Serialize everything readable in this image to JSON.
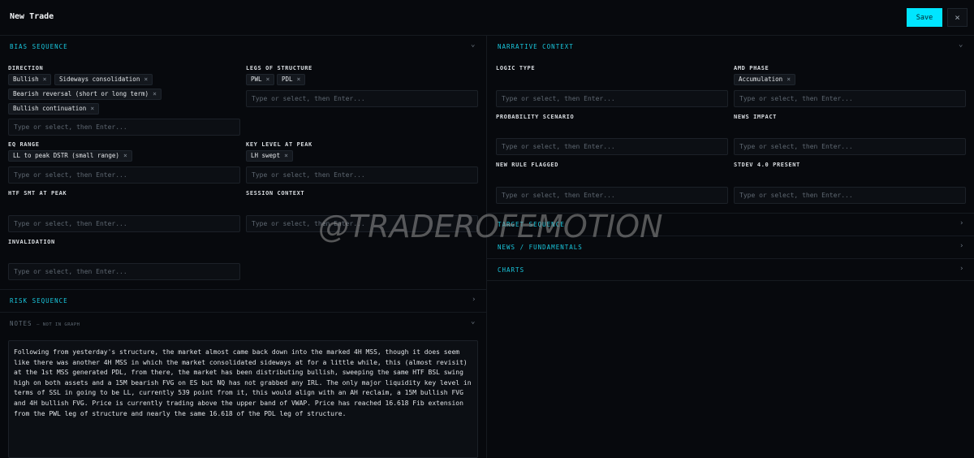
{
  "header": {
    "title": "New Trade",
    "save_label": "Save",
    "close_glyph": "×"
  },
  "placeholder": "Type or select, then Enter...",
  "remove_glyph": "×",
  "chevrons": {
    "collapse": "⌄",
    "expand": "›"
  },
  "bias": {
    "title": "BIAS SEQUENCE",
    "direction": {
      "label": "DIRECTION",
      "tags": [
        "Bullish",
        "Sideways consolidation",
        "Bearish reversal (short or long term)",
        "Bullish continuation"
      ]
    },
    "legs": {
      "label": "LEGS OF STRUCTURE",
      "tags": [
        "PWL",
        "PDL"
      ]
    },
    "eq_range": {
      "label": "EQ RANGE",
      "tags": [
        "LL to peak DSTR (small range)"
      ]
    },
    "key_level": {
      "label": "KEY LEVEL AT PEAK",
      "tags": [
        "LH swept"
      ]
    },
    "htf_smt": {
      "label": "HTF SMT AT PEAK"
    },
    "session": {
      "label": "SESSION CONTEXT"
    },
    "invalidation": {
      "label": "INVALIDATION"
    }
  },
  "risk": {
    "title": "RISK SEQUENCE"
  },
  "notes": {
    "title": "NOTES",
    "subtitle": "— NOT IN GRAPH",
    "text": "Following from yesterday's structure, the market almost came back down into the marked 4H MSS, though it does seem like there was another 4H MSS in which the market consolidated sideways at for a little while, this (almost revisit) at the 1st MSS generated PDL, from there, the market has been distributing bullish, sweeping the same HTF BSL swing high on both assets and a 15M bearish FVG on ES but NQ has not grabbed any IRL. The only major liquidity key level in terms of SSL in going to be LL, currently 539 point from it, this would align with an AH reclaim, a 15M bullish FVG and 4H bullish FVG. Price is currently trading above the upper band of VWAP. Price has reached 16.618 Fib extension from the PWL leg of structure and nearly the same 16.618 of the PDL leg of structure."
  },
  "narrative": {
    "title": "NARRATIVE CONTEXT",
    "logic_type": {
      "label": "LOGIC TYPE"
    },
    "amd_phase": {
      "label": "AMD PHASE",
      "tags": [
        "Accumulation"
      ]
    },
    "probability": {
      "label": "PROBABILITY SCENARIO"
    },
    "news_impact": {
      "label": "NEWS IMPACT"
    },
    "new_rule": {
      "label": "NEW RULE FLAGGED"
    },
    "stdev": {
      "label": "STDEV 4.0 PRESENT"
    }
  },
  "target": {
    "title": "TARGET SEQUENCE"
  },
  "news": {
    "title": "NEWS / FUNDAMENTALS"
  },
  "charts": {
    "title": "CHARTS"
  },
  "watermark": "@TRADEROFEMOTION",
  "colors": {
    "accent": "#00e5ff",
    "section_title": "#19c6dc",
    "background": "#07090d"
  }
}
